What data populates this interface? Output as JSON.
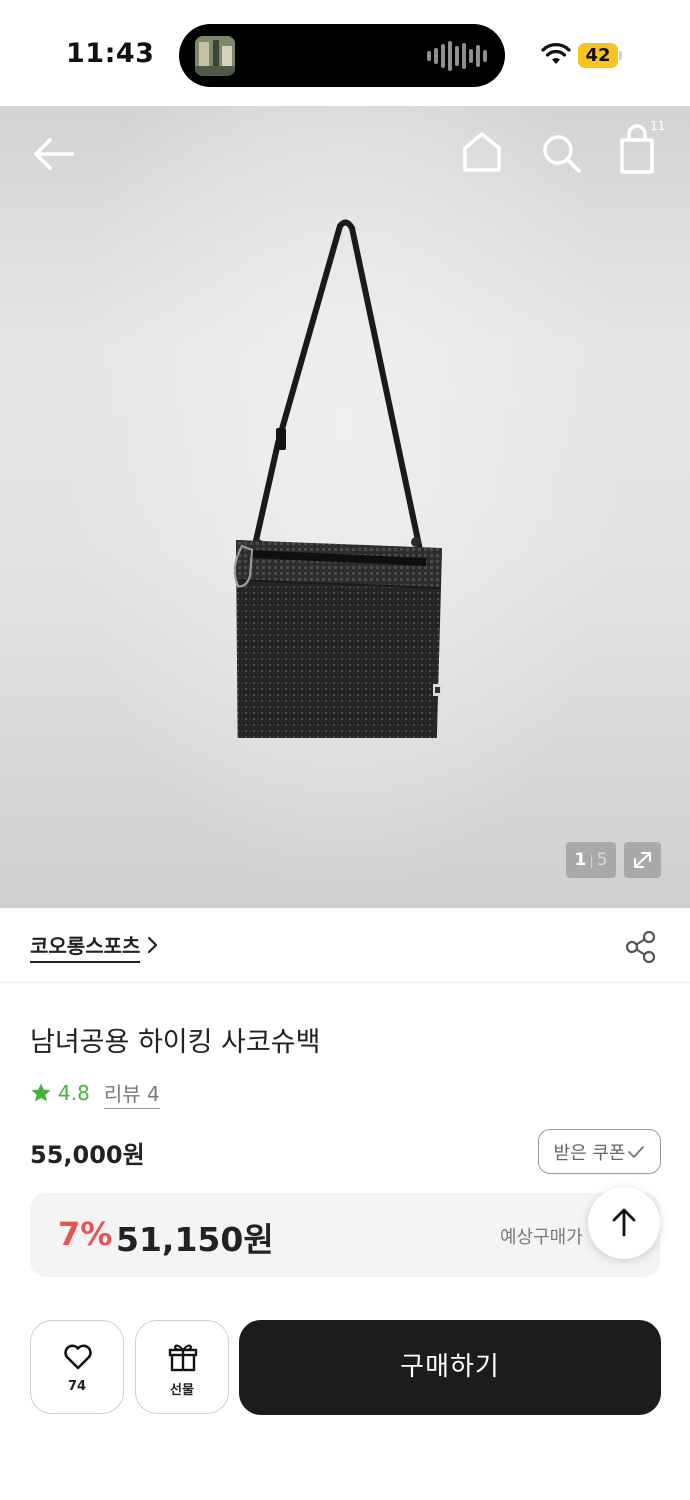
{
  "status_bar": {
    "time": "11:43",
    "battery": "42",
    "battery_color": "#f7c51e"
  },
  "hero": {
    "image_alt": "black mesh sacoche shoulder bag",
    "cart_count": "11",
    "page_current": "1",
    "page_total": "5",
    "icons": [
      "back-arrow-icon",
      "home-icon",
      "search-icon",
      "shopping-bag-icon",
      "expand-icon"
    ]
  },
  "brand": {
    "name": "코오롱스포츠"
  },
  "product": {
    "title": "남녀공용 하이킹 사코슈백",
    "rating": "4.8",
    "review": "리뷰 4",
    "original_price": "55,000원",
    "coupon_label": "받은 쿠폰",
    "discount_rate": "7%",
    "sale_price": "51,150원",
    "expected_label": "예상구매가"
  },
  "actions": {
    "like_count": "74",
    "gift_label": "선물",
    "buy_label": "구매하기"
  },
  "colors": {
    "discount": "#ea5353",
    "rating": "#44b23f",
    "buy_button": "#1c1c1c"
  }
}
